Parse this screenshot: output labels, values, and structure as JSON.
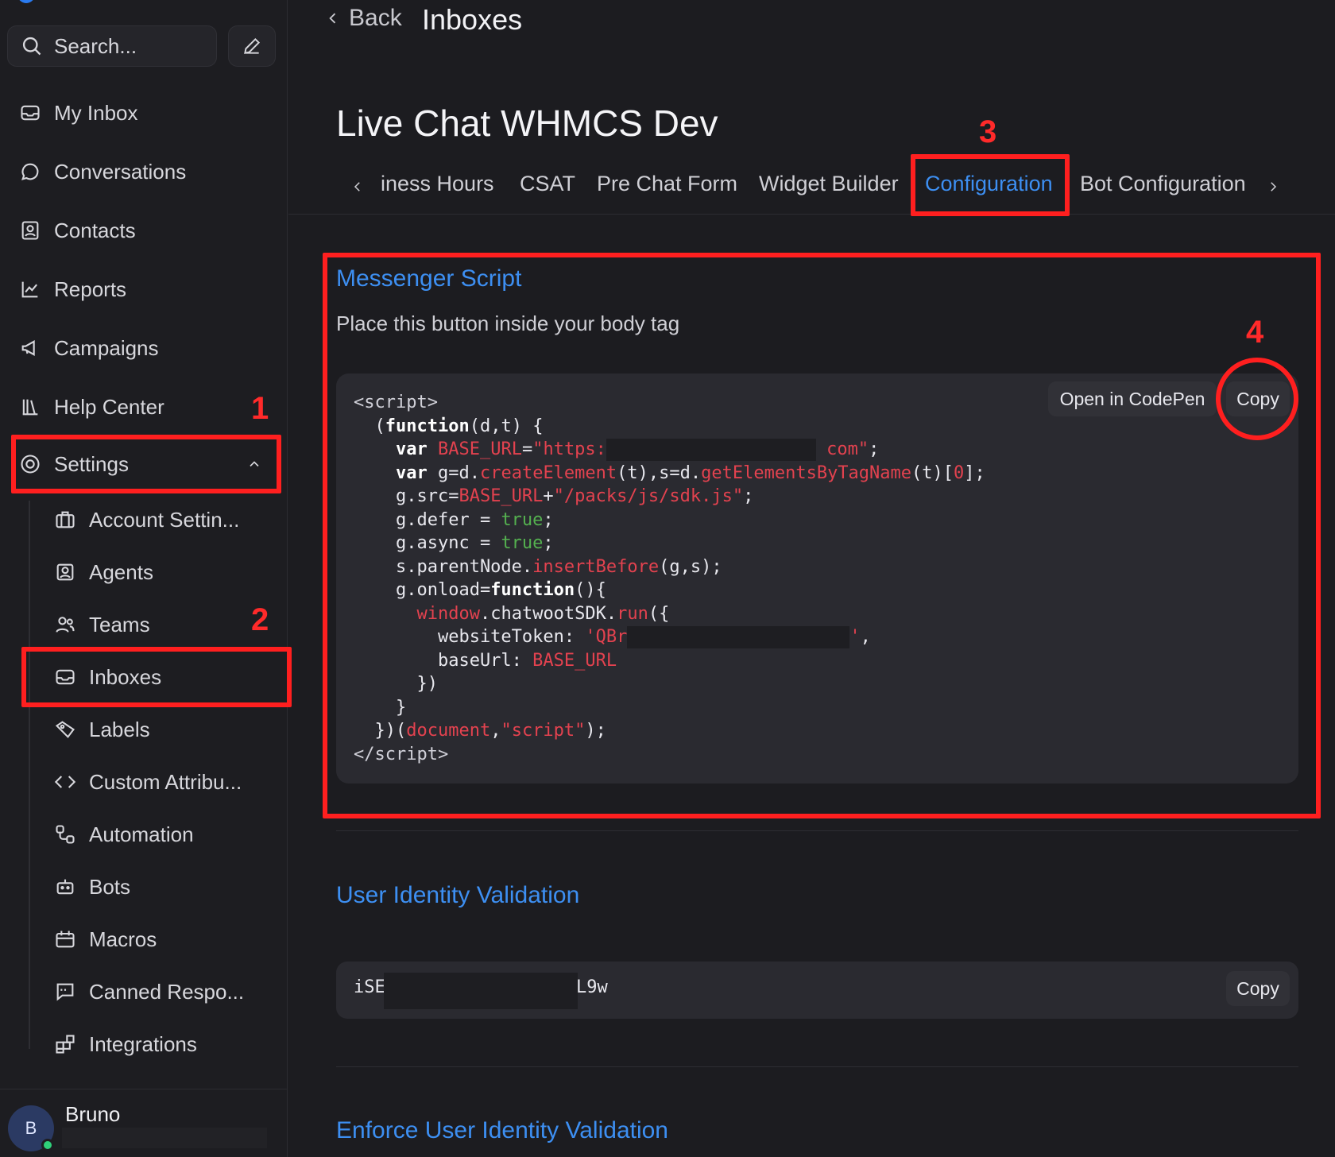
{
  "search": {
    "placeholder": "Search..."
  },
  "nav": [
    {
      "label": "My Inbox",
      "icon": "inbox-icon"
    },
    {
      "label": "Conversations",
      "icon": "chat-bubble-icon"
    },
    {
      "label": "Contacts",
      "icon": "contact-card-icon"
    },
    {
      "label": "Reports",
      "icon": "line-chart-icon"
    },
    {
      "label": "Campaigns",
      "icon": "megaphone-icon"
    },
    {
      "label": "Help Center",
      "icon": "library-icon"
    },
    {
      "label": "Settings",
      "icon": "gear-icon"
    }
  ],
  "settings_items": [
    {
      "label": "Account Settin...",
      "icon": "briefcase-icon"
    },
    {
      "label": "Agents",
      "icon": "user-square-icon"
    },
    {
      "label": "Teams",
      "icon": "people-icon"
    },
    {
      "label": "Inboxes",
      "icon": "inbox-icon"
    },
    {
      "label": "Labels",
      "icon": "tag-icon"
    },
    {
      "label": "Custom Attribu...",
      "icon": "code-icon"
    },
    {
      "label": "Automation",
      "icon": "flow-icon"
    },
    {
      "label": "Bots",
      "icon": "robot-icon"
    },
    {
      "label": "Macros",
      "icon": "calendar-icon"
    },
    {
      "label": "Canned Respo...",
      "icon": "message-square-icon"
    },
    {
      "label": "Integrations",
      "icon": "puzzle-icon"
    }
  ],
  "user": {
    "name": "Bruno",
    "initial": "B"
  },
  "header": {
    "back_label": "Back",
    "breadcrumb": "Inboxes"
  },
  "inbox": {
    "title": "Live Chat WHMCS Dev"
  },
  "tabs": [
    {
      "label": "iness Hours"
    },
    {
      "label": "CSAT"
    },
    {
      "label": "Pre Chat Form"
    },
    {
      "label": "Widget Builder"
    },
    {
      "label": "Configuration",
      "active": true
    },
    {
      "label": "Bot Configuration"
    }
  ],
  "messenger": {
    "title": "Messenger Script",
    "description": "Place this button inside your body tag",
    "open_codepen": "Open in CodePen",
    "copy": "Copy"
  },
  "identity": {
    "title": "User Identity Validation",
    "value_start": "iSE",
    "value_end": "L9w",
    "copy": "Copy"
  },
  "enforce": {
    "title": "Enforce User Identity Validation"
  },
  "annotations": [
    "1",
    "2",
    "3",
    "4"
  ],
  "colors": {
    "accent": "#3d8ff2",
    "annotation": "#ff1f1f"
  }
}
